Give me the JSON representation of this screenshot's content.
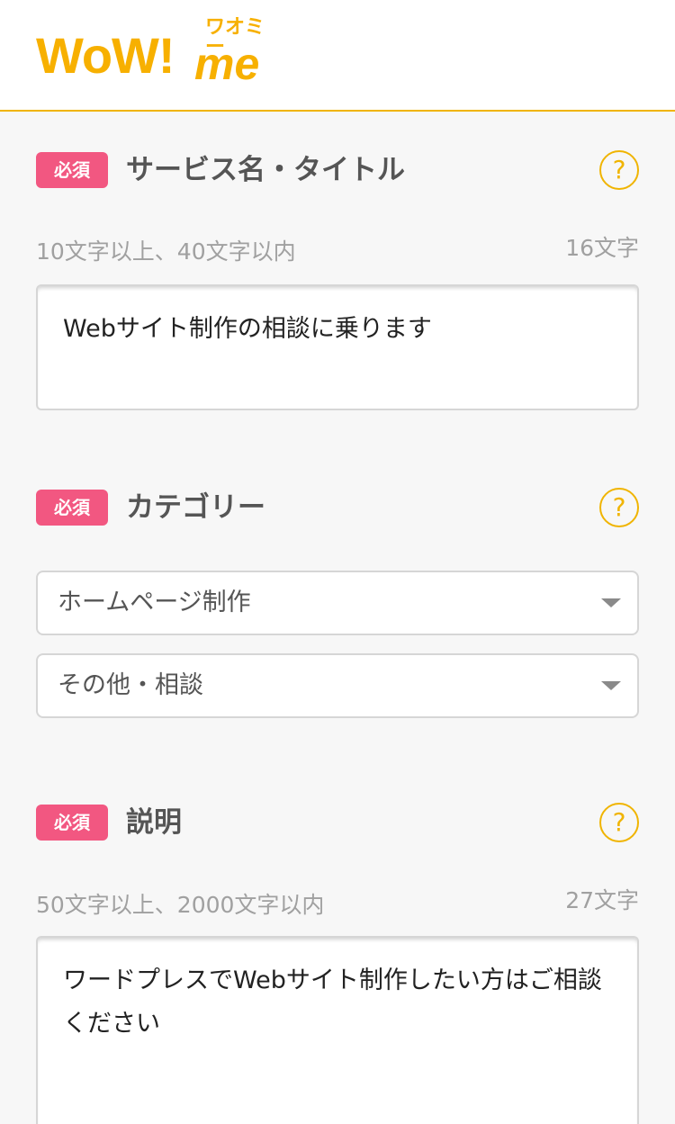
{
  "header": {
    "logo_main": "WoW!",
    "logo_me": "me",
    "logo_kana": "ワオミー"
  },
  "badge_required": "必須",
  "help_symbol": "?",
  "sections": {
    "title": {
      "label": "サービス名・タイトル",
      "hint": "10文字以上、40文字以内",
      "count": "16文字",
      "value": "Webサイト制作の相談に乗ります"
    },
    "category": {
      "label": "カテゴリー",
      "select1": "ホームページ制作",
      "select2": "その他・相談"
    },
    "description": {
      "label": "説明",
      "hint": "50文字以上、2000文字以内",
      "count": "27文字",
      "value": "ワードプレスでWebサイト制作したい方はご相談ください"
    }
  },
  "colors": {
    "accent": "#f0b400",
    "badge": "#f25781",
    "background": "#f7f7f7"
  },
  "icons": [
    "help-icon",
    "chevron-down-icon"
  ]
}
